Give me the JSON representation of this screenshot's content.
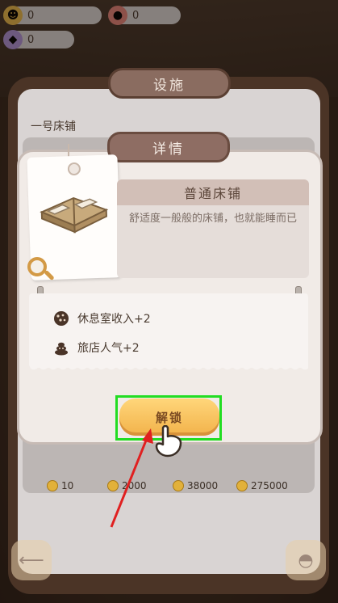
{
  "resources": {
    "coins": "0",
    "popularity": "0",
    "gems": "0"
  },
  "settings_panel": {
    "title": "设施",
    "subtitle": "一号床铺",
    "prices": [
      "10",
      "2000",
      "38000",
      "275000"
    ]
  },
  "detail_dialog": {
    "title": "详情",
    "item_name": "普通床铺",
    "description": "舒适度一般般的床铺，也就能睡而已",
    "stats": [
      {
        "icon": "cookie-icon",
        "text": "休息室收入+2"
      },
      {
        "icon": "poop-icon",
        "text": "旅店人气+2"
      }
    ],
    "unlock_label": "解锁"
  },
  "colors": {
    "highlight": "#22dd22",
    "button": "#f2b24a",
    "arrow": "#e02020"
  }
}
